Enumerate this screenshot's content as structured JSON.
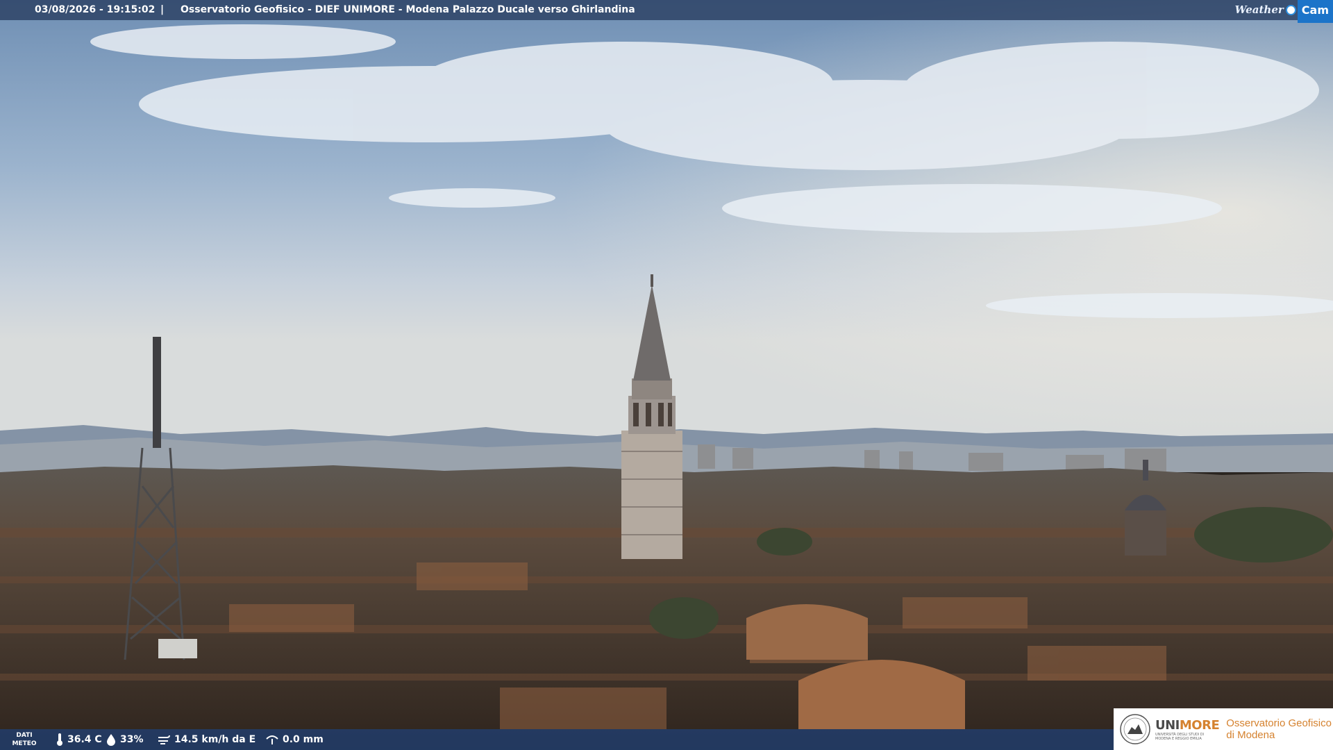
{
  "overlay": {
    "datetime": "03/08/2026 - 19:15:02",
    "separator": "|",
    "title": "Osservatorio Geofisico - DIEF UNIMORE - Modena Palazzo Ducale verso Ghirlandina",
    "logo_weather": "Weather",
    "logo_cam": "Cam"
  },
  "weather": {
    "label_line1": "DATI",
    "label_line2": "METEO",
    "temperature": "36.4 C",
    "humidity": "33%",
    "wind": "14.5 km/h da E",
    "rain": "0.0 mm",
    "icons": [
      "thermometer-icon",
      "humidity-drop-icon",
      "wind-icon",
      "rain-gauge-icon"
    ]
  },
  "branding": {
    "uni_part1": "UNI",
    "uni_part2": "MORE",
    "uni_sub1": "UNIVERSITÀ DEGLI STUDI DI",
    "uni_sub2": "MODENA E REGGIO EMILIA",
    "observatory_line1": "Osservatorio Geofisico",
    "observatory_line2": "di Modena"
  },
  "colors": {
    "bar": "#283c5f",
    "accent_orange": "#d5822f",
    "cam_blue": "#1c74c9"
  }
}
